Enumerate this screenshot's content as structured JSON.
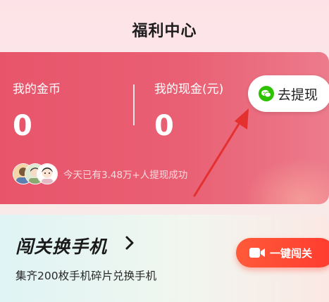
{
  "header": {
    "title": "福利中心"
  },
  "wallet": {
    "coin_label": "我的金币",
    "coin_value": "0",
    "cash_label": "我的现金(元)",
    "cash_value": "0",
    "withdraw_label": "去提现",
    "withdraw_icon": "wechat-icon",
    "social_proof": "今天已有3.48万+人提现成功",
    "colors": {
      "card": "#e8556b",
      "button_bg": "#ffffff",
      "wechat_green": "#2dc100"
    }
  },
  "challenge": {
    "title": "闯关换手机",
    "subtitle": "集齐200枚手机碎片兑换手机",
    "button_label": "一键闯关",
    "button_icon": "video-camera-icon",
    "colors": {
      "button": "#ff4a34"
    }
  },
  "annotation": {
    "icon": "red-arrow",
    "color": "#e53030"
  }
}
